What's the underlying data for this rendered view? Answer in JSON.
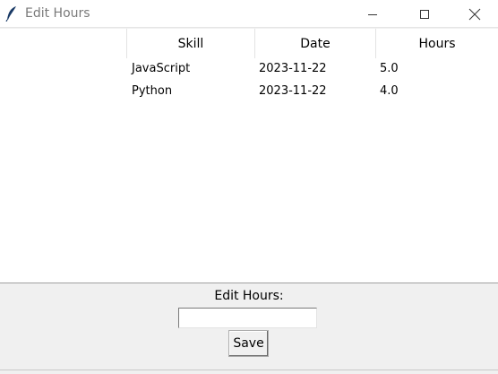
{
  "window": {
    "title": "Edit Hours",
    "icons": {
      "app": "feather-icon",
      "minimize": "minimize-icon",
      "maximize": "maximize-icon",
      "close": "close-icon"
    }
  },
  "table": {
    "columns": [
      "Skill",
      "Date",
      "Hours"
    ],
    "rows": [
      {
        "skill": "JavaScript",
        "date": "2023-11-22",
        "hours": "5.0"
      },
      {
        "skill": "Python",
        "date": "2023-11-22",
        "hours": "4.0"
      }
    ]
  },
  "editor": {
    "label": "Edit Hours:",
    "input_value": "",
    "save_label": "Save"
  }
}
